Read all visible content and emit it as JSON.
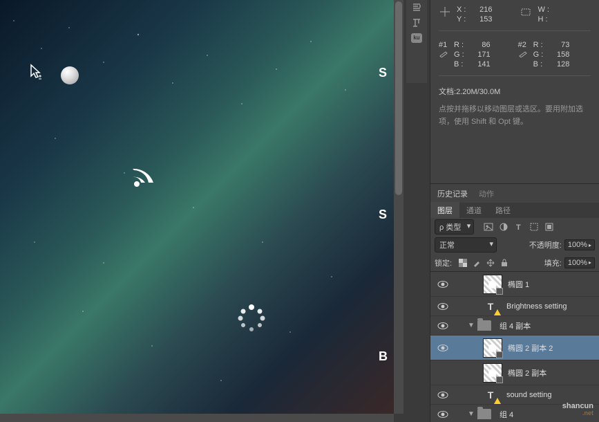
{
  "info": {
    "x_label": "X :",
    "x_value": "216",
    "y_label": "Y :",
    "y_value": "153",
    "w_label": "W :",
    "w_value": "",
    "h_label": "H :",
    "h_value": "",
    "sample1": {
      "num": "#1",
      "r_label": "R :",
      "r": "86",
      "g_label": "G :",
      "g": "171",
      "b_label": "B :",
      "b": "141"
    },
    "sample2": {
      "num": "#2",
      "r_label": "R :",
      "r": "73",
      "g_label": "G :",
      "g": "158",
      "b_label": "B :",
      "b": "128"
    },
    "doc_label": "文档:",
    "doc_value": "2.20M/30.0M",
    "hint": "点按并拖移以移动图层或选区。要用附加选项，使用 Shift 和 Opt 键。"
  },
  "history_tabs": {
    "history": "历史记录",
    "actions": "动作"
  },
  "panel_tabs": {
    "layers": "图层",
    "channels": "通道",
    "paths": "路径"
  },
  "filter": {
    "type_prefix": "ρ",
    "type_label": "类型"
  },
  "blend": {
    "mode": "正常",
    "opacity_label": "不透明度:",
    "opacity_value": "100%"
  },
  "lock": {
    "label": "锁定:",
    "fill_label": "填充:",
    "fill_value": "100%"
  },
  "layers": [
    {
      "name": "椭圆 1",
      "kind": "shape",
      "indent": 2,
      "visible": true
    },
    {
      "name": "Brightness setting",
      "kind": "text",
      "indent": 2,
      "visible": true,
      "warn": true
    },
    {
      "name": "组 4 副本",
      "kind": "folder",
      "indent": 1,
      "visible": true,
      "expanded": true
    },
    {
      "name": "椭圆 2 副本 2",
      "kind": "shape",
      "indent": 2,
      "visible": true,
      "selected": true
    },
    {
      "name": "椭圆 2 副本",
      "kind": "shape",
      "indent": 2,
      "visible": false
    },
    {
      "name": "sound setting",
      "kind": "text",
      "indent": 2,
      "visible": true,
      "warn": true
    },
    {
      "name": "组 4",
      "kind": "folder",
      "indent": 1,
      "visible": true,
      "expanded": true
    }
  ],
  "canvas_letters": {
    "s1": "S",
    "s2": "S",
    "b": "B"
  },
  "watermark": {
    "main": "shancun",
    "sub": ".net"
  }
}
